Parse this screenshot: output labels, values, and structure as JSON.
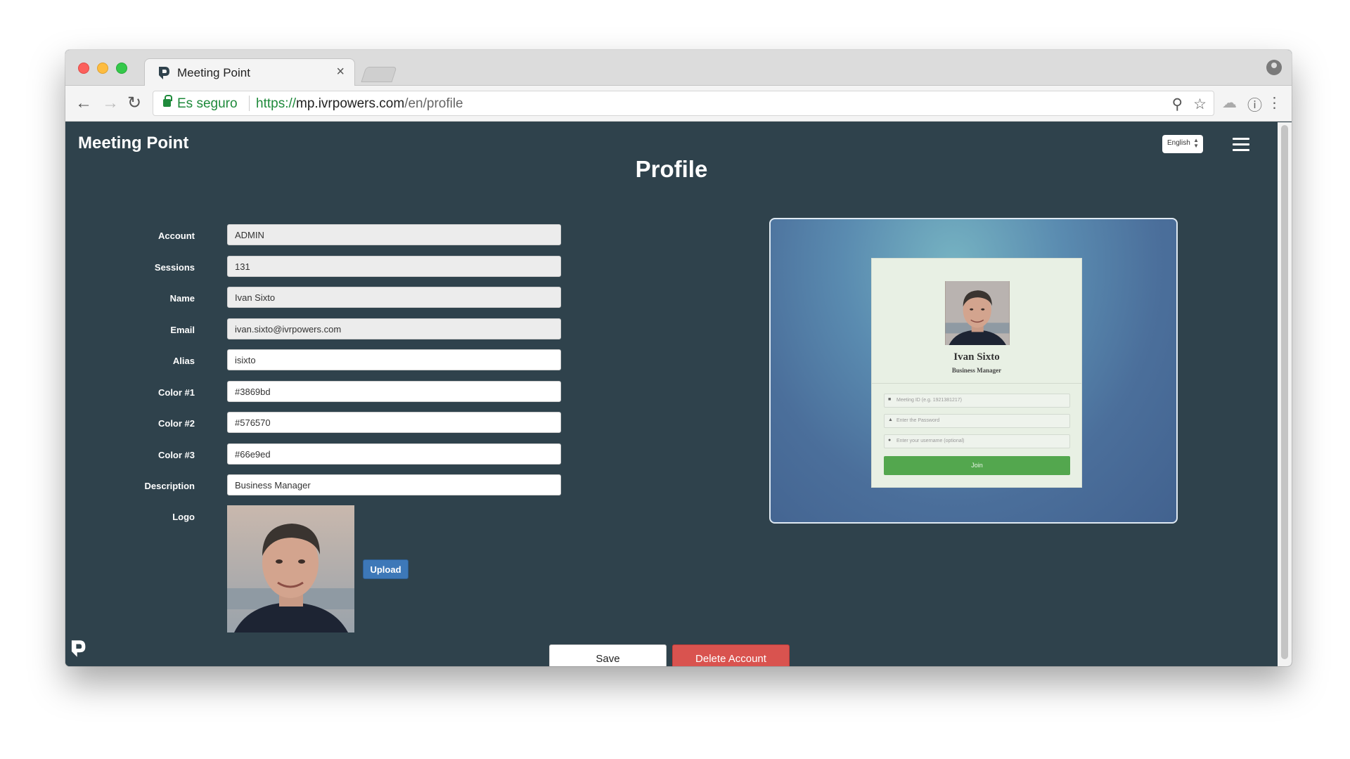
{
  "browser": {
    "tab_title": "Meeting Point",
    "tab_close": "×",
    "secure_label": "Es seguro",
    "url_scheme": "https://",
    "url_host": "mp.ivrpowers.com",
    "url_path": "/en/profile",
    "icons": {
      "back": "←",
      "forward": "→",
      "reload": "↻",
      "zoom": "⚲",
      "star": "☆",
      "cloud": "☁",
      "info": "ⓘ",
      "menu": "⋮"
    }
  },
  "header": {
    "brand": "Meeting Point",
    "language": "English",
    "language_arrows": "▲▼"
  },
  "page_title": "Profile",
  "form": {
    "account": {
      "label": "Account",
      "value": "ADMIN"
    },
    "sessions": {
      "label": "Sessions",
      "value": "131"
    },
    "name": {
      "label": "Name",
      "value": "Ivan Sixto"
    },
    "email": {
      "label": "Email",
      "value": "ivan.sixto@ivrpowers.com"
    },
    "alias": {
      "label": "Alias",
      "value": "isixto"
    },
    "color1": {
      "label": "Color #1",
      "value": "#3869bd"
    },
    "color2": {
      "label": "Color #2",
      "value": "#576570"
    },
    "color3": {
      "label": "Color #3",
      "value": "#66e9ed"
    },
    "description": {
      "label": "Description",
      "value": "Business Manager"
    },
    "logo": {
      "label": "Logo"
    },
    "upload_label": "Upload"
  },
  "actions": {
    "save": "Save",
    "delete": "Delete Account"
  },
  "preview": {
    "name": "Ivan Sixto",
    "role": "Business Manager",
    "meeting_id_placeholder": "Meeting ID (e.g. 1921381217)",
    "password_placeholder": "Enter the Password",
    "username_placeholder": "Enter your username (optional)",
    "join": "Join",
    "icons": {
      "video": "■",
      "lock": "▲",
      "user": "●"
    }
  },
  "colors": {
    "page_background": "#2f424c",
    "primary": "#3d78b8",
    "danger": "#d9534f",
    "join_green": "#53a74e",
    "secure_green": "#1f8a3b"
  }
}
